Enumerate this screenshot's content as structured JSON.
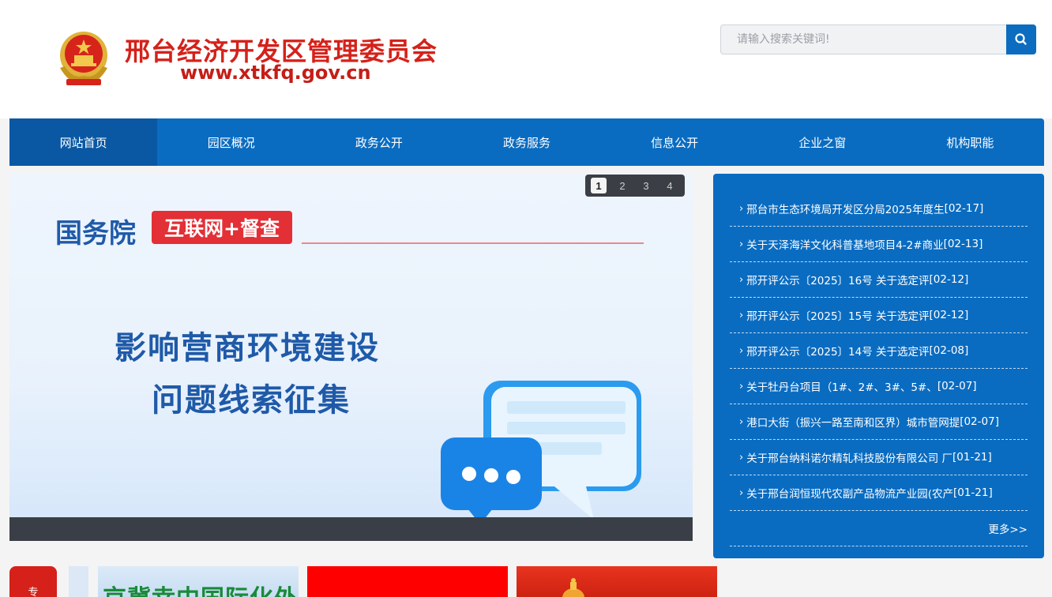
{
  "header": {
    "site_title": "邢台经济开发区管理委员会",
    "site_url": "www.xtkfq.gov.cn",
    "emblem_icon": "national-emblem-icon",
    "search_placeholder": "请输入搜索关键词!",
    "search_icon": "search-icon"
  },
  "nav": {
    "items": [
      {
        "label": "网站首页",
        "active": true
      },
      {
        "label": "园区概况",
        "active": false
      },
      {
        "label": "政务公开",
        "active": false
      },
      {
        "label": "政务服务",
        "active": false
      },
      {
        "label": "信息公开",
        "active": false
      },
      {
        "label": "企业之窗",
        "active": false
      },
      {
        "label": "机构职能",
        "active": false
      }
    ]
  },
  "banner": {
    "org": "国务院",
    "tag": "互联网+督查",
    "headline_line1": "影响营商环境建设",
    "headline_line2": "问题线索征集",
    "pager": [
      "1",
      "2",
      "3",
      "4"
    ],
    "pager_active": 0
  },
  "news": {
    "items": [
      {
        "text": "邢台市生态环境局开发区分局2025年度生",
        "date": "[02-17]"
      },
      {
        "text": "关于天泽海洋文化科普基地项目4-2#商业",
        "date": "[02-13]"
      },
      {
        "text": "邢开评公示〔2025〕16号 关于选定评",
        "date": "[02-12]"
      },
      {
        "text": "邢开评公示〔2025〕15号 关于选定评",
        "date": "[02-12]"
      },
      {
        "text": "邢开评公示〔2025〕14号 关于选定评",
        "date": "[02-08]"
      },
      {
        "text": "关于牡丹台项目（1#、2#、3#、5#、",
        "date": "[02-07]"
      },
      {
        "text": "港口大街（振兴一路至南和区界）城市管网提",
        "date": "[02-07]"
      },
      {
        "text": "关于邢台纳科诺尔精轧科技股份有限公司 厂",
        "date": "[01-21]"
      },
      {
        "text": "关于邢台润恒现代农副产品物流产业园(农产",
        "date": "[01-21]"
      }
    ],
    "more": "更多>>"
  },
  "bottom": {
    "zt_label": "专",
    "card1_text": "京冀幸中国际化外"
  },
  "colors": {
    "brand_blue": "#0a6cc1",
    "nav_active": "#0a58a4",
    "title_red": "#d5211a"
  }
}
